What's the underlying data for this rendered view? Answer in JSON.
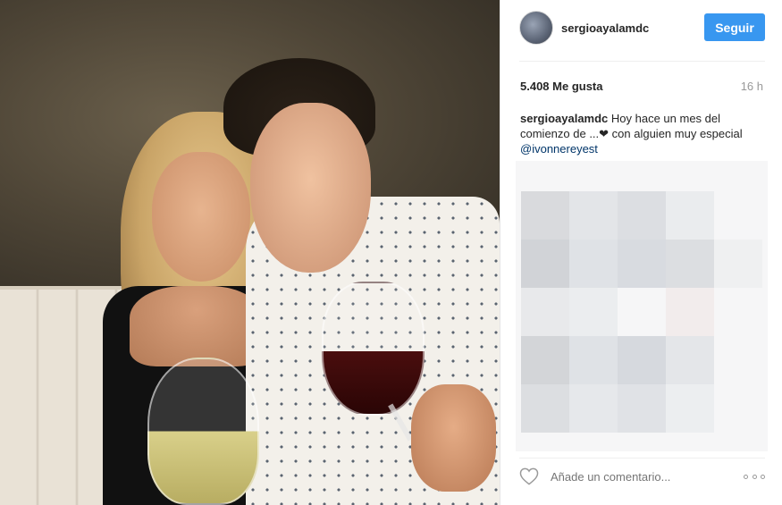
{
  "post": {
    "username": "sergioayalamdc",
    "follow_label": "Seguir",
    "likes": "5.408 Me gusta",
    "time": "16 h",
    "caption_user": "sergioayalamdc",
    "caption_text": " Hoy hace un mes del comienzo de ...❤ con alguien muy especial",
    "mention": "@ivonnereyest"
  },
  "comment": {
    "placeholder": "Añade un comentario..."
  },
  "colors": {
    "follow_button": "#3897f0",
    "mention": "#003569",
    "muted": "#999999"
  },
  "icons": {
    "like": "heart-icon",
    "more": "more-options-icon"
  }
}
